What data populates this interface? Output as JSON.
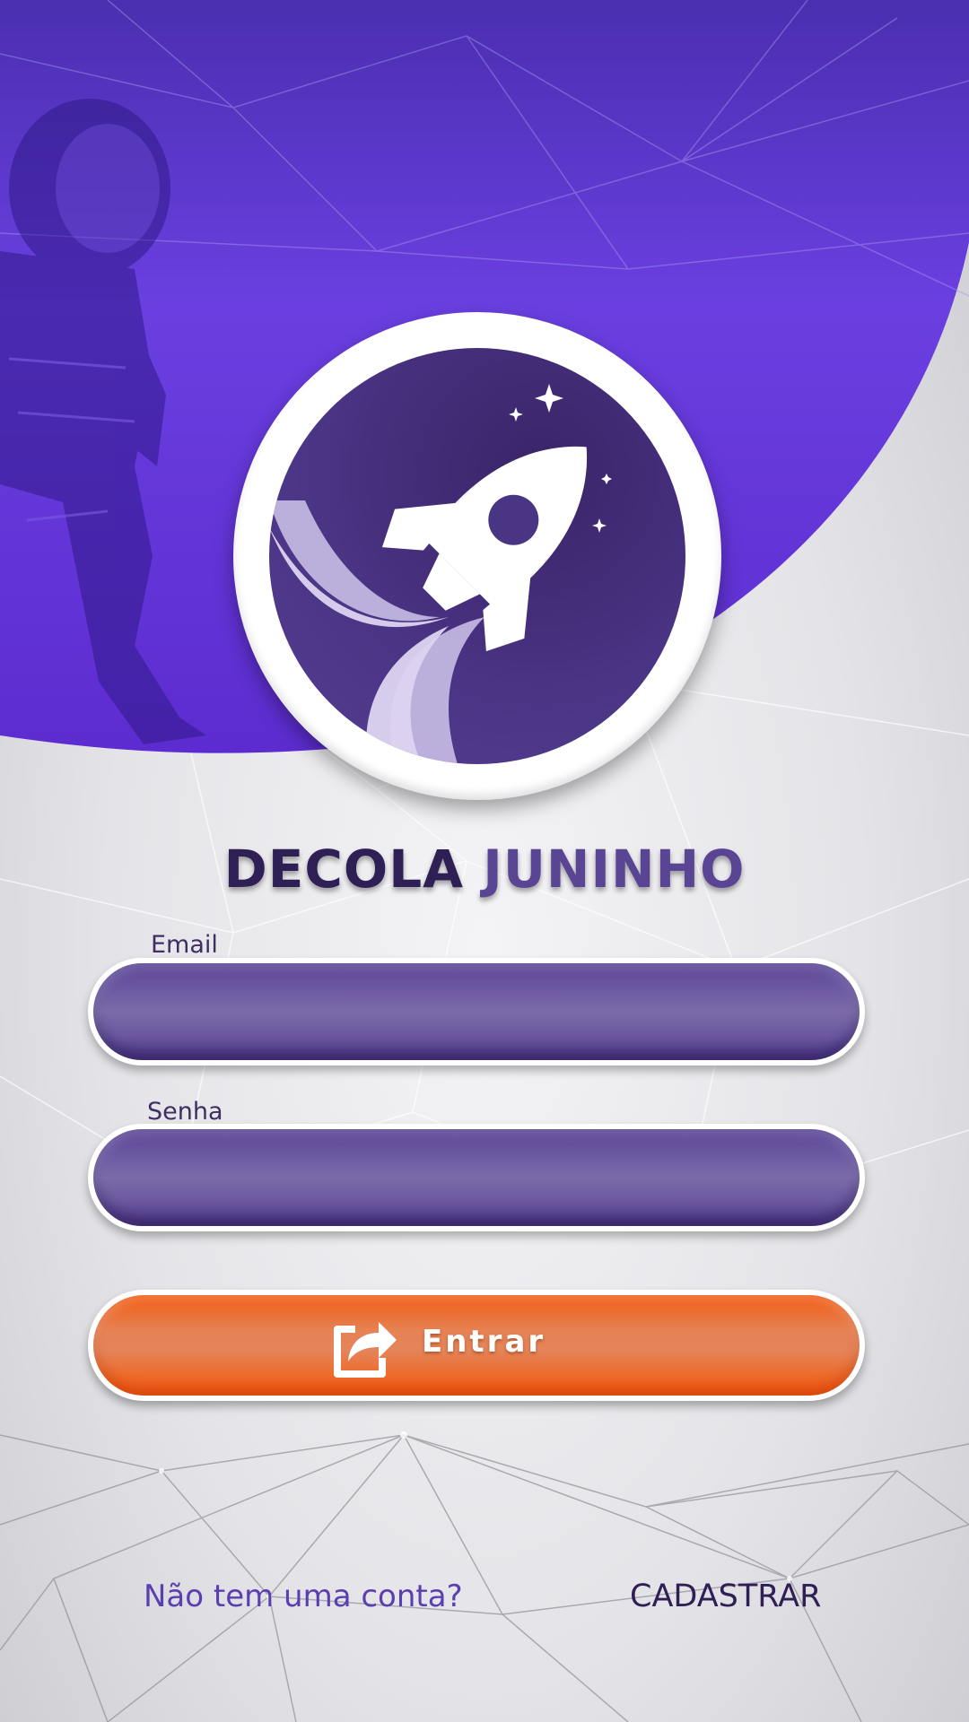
{
  "brand": {
    "title_part1": "DECOLA",
    "title_part2": "JUNINHO",
    "logo_icon": "rocket-icon"
  },
  "form": {
    "email_label": "Email",
    "email_value": "",
    "password_label": "Senha",
    "password_value": "",
    "submit_label": "Entrar",
    "submit_icon": "share-arrow-icon"
  },
  "footer": {
    "question": "Não tem uma conta?",
    "signup_link": "CADASTRAR"
  },
  "colors": {
    "primary_purple": "#5a4494",
    "deep_purple": "#2e1f55",
    "accent_orange": "#f25a12",
    "link_purple": "#5a3fb0"
  }
}
